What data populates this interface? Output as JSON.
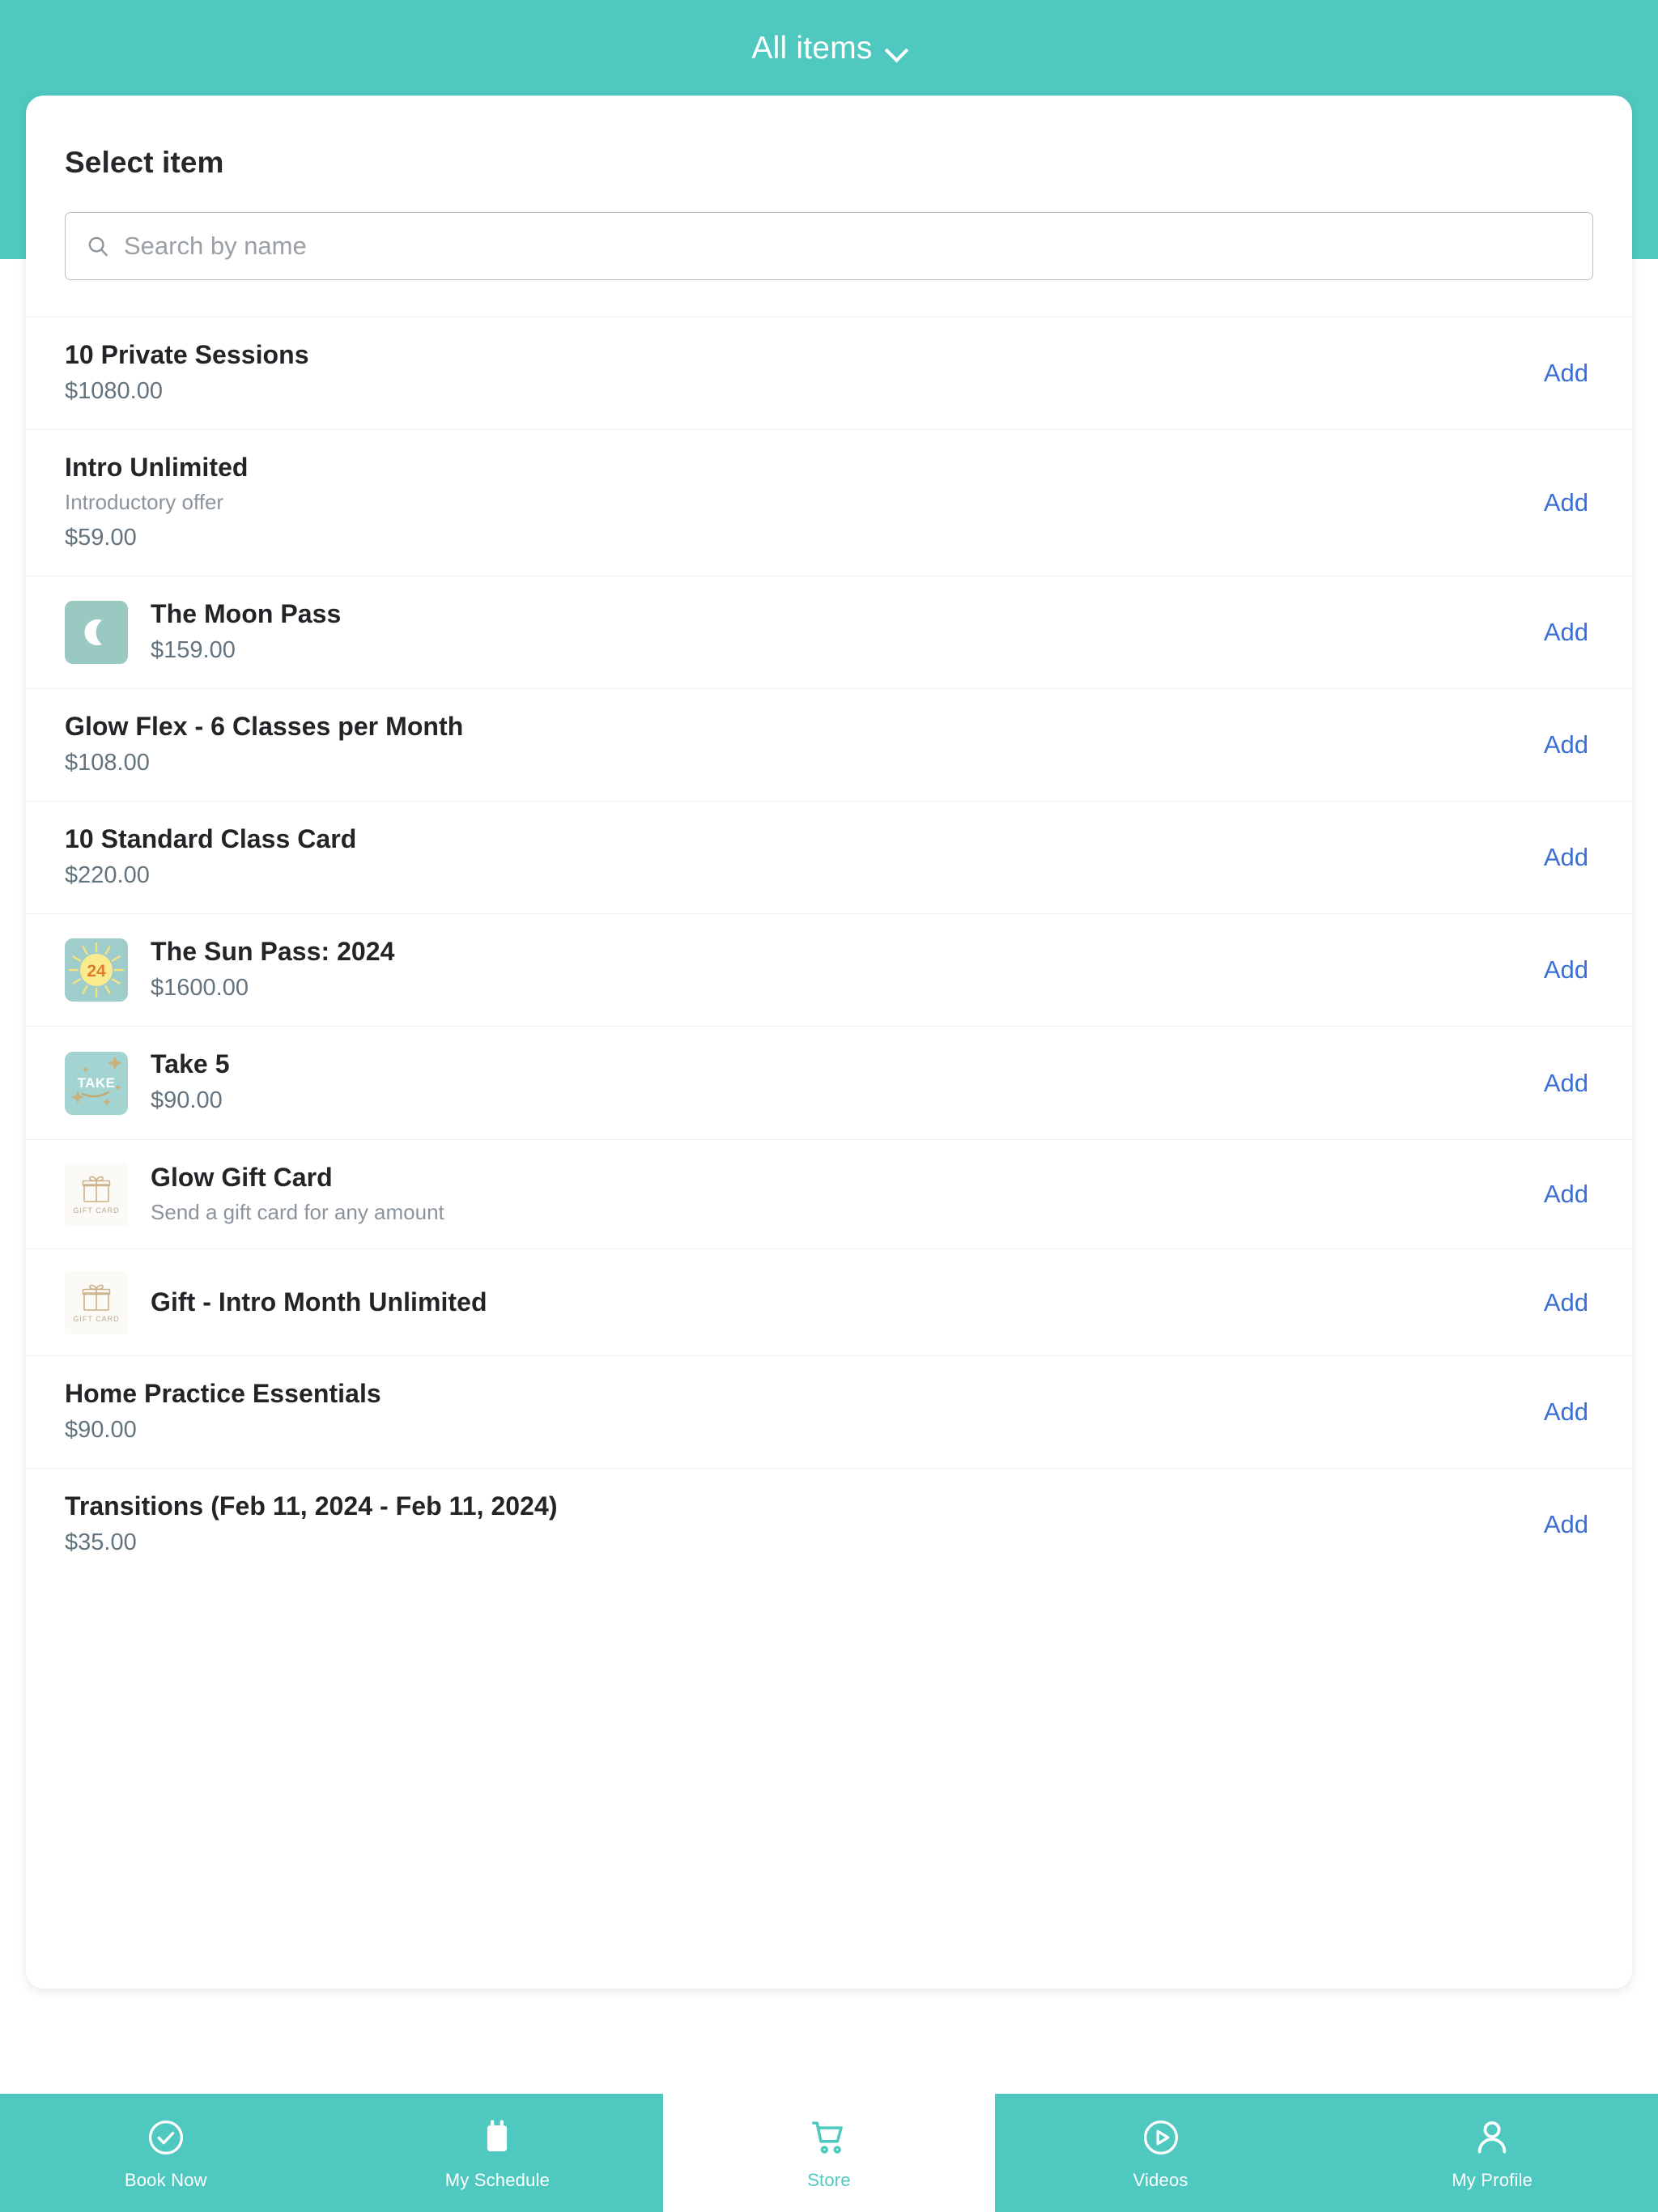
{
  "header": {
    "title": "All items",
    "chevron_icon": "chevron-down-icon",
    "cart_icon": "shopping-cart-icon",
    "accent_color": "#4fc9c0"
  },
  "sheet": {
    "title": "Select item"
  },
  "search": {
    "placeholder": "Search by name",
    "value": "",
    "icon": "search-icon"
  },
  "list": {
    "add_label": "Add",
    "items": [
      {
        "name": "10 Private Sessions",
        "subtitle": "",
        "price": "$1080.00",
        "thumb": "none",
        "add": "Add"
      },
      {
        "name": "Intro Unlimited",
        "subtitle": "Introductory offer",
        "price": "$59.00",
        "thumb": "none",
        "add": "Add"
      },
      {
        "name": "The Moon Pass",
        "subtitle": "",
        "price": "$159.00",
        "thumb": "moon",
        "add": "Add"
      },
      {
        "name": "Glow Flex - 6 Classes per Month",
        "subtitle": "",
        "price": "$108.00",
        "thumb": "none",
        "add": "Add"
      },
      {
        "name": "10 Standard Class Card",
        "subtitle": "",
        "price": "$220.00",
        "thumb": "none",
        "add": "Add"
      },
      {
        "name": "The Sun Pass: 2024",
        "subtitle": "",
        "price": "$1600.00",
        "thumb": "sun",
        "thumb_text": "24",
        "add": "Add"
      },
      {
        "name": "Take 5",
        "subtitle": "",
        "price": "$90.00",
        "thumb": "take",
        "thumb_text": "TAKE",
        "add": "Add"
      },
      {
        "name": "Glow Gift Card",
        "subtitle": "Send a gift card for any amount",
        "price": "",
        "thumb": "giftcard",
        "thumb_text": "GIFT CARD",
        "add": "Add"
      },
      {
        "name": "Gift - Intro Month Unlimited",
        "subtitle": "",
        "price": "",
        "thumb": "giftcard",
        "thumb_text": "GIFT CARD",
        "add": "Add"
      },
      {
        "name": "Home Practice Essentials",
        "subtitle": "",
        "price": "$90.00",
        "thumb": "none",
        "add": "Add"
      },
      {
        "name": "Transitions (Feb 11, 2024 - Feb 11, 2024)",
        "subtitle": "",
        "price": "$35.00",
        "thumb": "none",
        "add": "Add"
      }
    ]
  },
  "bottom_nav": {
    "items": [
      {
        "label": "Book Now",
        "icon": "check-circle-icon",
        "active": false
      },
      {
        "label": "My Schedule",
        "icon": "calendar-icon",
        "active": false
      },
      {
        "label": "Store",
        "icon": "shopping-cart-icon",
        "active": true
      },
      {
        "label": "Videos",
        "icon": "play-circle-icon",
        "active": false
      },
      {
        "label": "My Profile",
        "icon": "person-icon",
        "active": false
      }
    ]
  }
}
